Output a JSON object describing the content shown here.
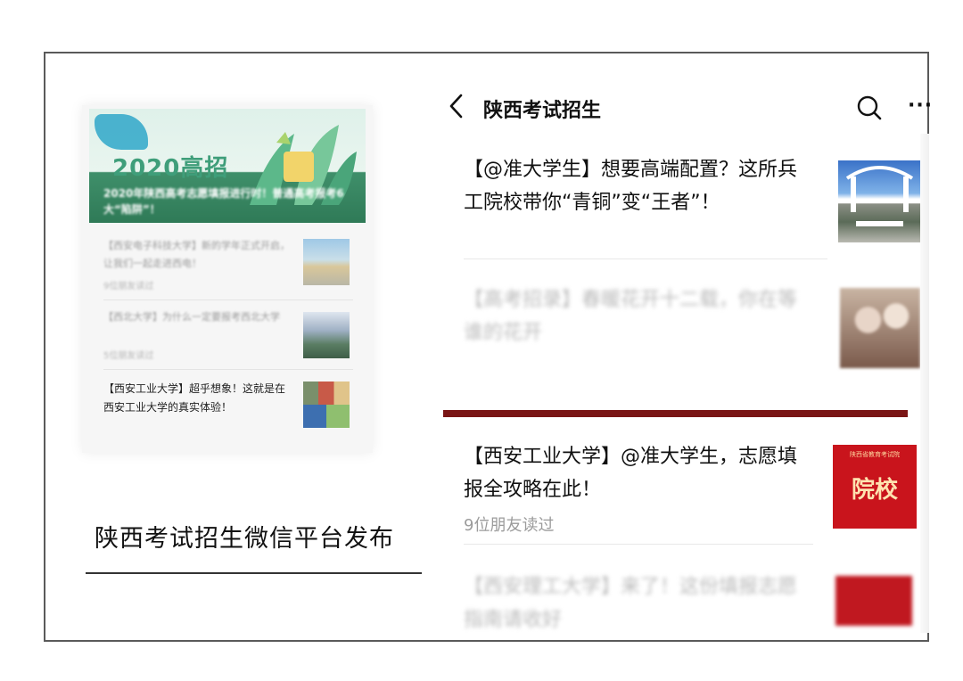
{
  "left_card": {
    "banner_year": "2020高招",
    "banner_title": "2020年陕西高考志愿填报进行时！普通高考报考6大“陷阱”！",
    "items": [
      {
        "text": "【西安电子科技大学】新的学年正式开启，让我们一起走进西电！",
        "meta": "9位朋友读过",
        "blurred": true
      },
      {
        "text": "【西北大学】为什么一定要报考西北大学",
        "meta": "5位朋友读过",
        "blurred": true
      },
      {
        "text": "【西安工业大学】超乎想象！这就是在西安工业大学的真实体验！",
        "meta": "",
        "blurred": false
      }
    ]
  },
  "caption": "陕西考试招生微信平台发布",
  "header": {
    "title": "陕西考试招生",
    "more": "···"
  },
  "articles": [
    {
      "text": "【@准大学生】想要高端配置？这所兵工院校带你“青铜”变“王者”！",
      "meta": "",
      "blurred": false
    },
    {
      "text": "【高考招录】春暖花开十二载，你在等谁的花开",
      "meta": "",
      "blurred": true
    },
    {
      "text": "【西安工业大学】@准大学生，志愿填报全攻略在此！",
      "meta": "9位朋友读过",
      "blurred": false
    },
    {
      "text": "【西安理工大学】来了！这份填报志愿指南请收好",
      "meta": "",
      "blurred": true
    }
  ],
  "thumb_seal": {
    "top": "陕西省教育考试院",
    "main": "院校"
  },
  "colors": {
    "accent_bar": "#7a1515",
    "seal_red": "#c9141c",
    "banner_green": "#3f8f6a"
  }
}
